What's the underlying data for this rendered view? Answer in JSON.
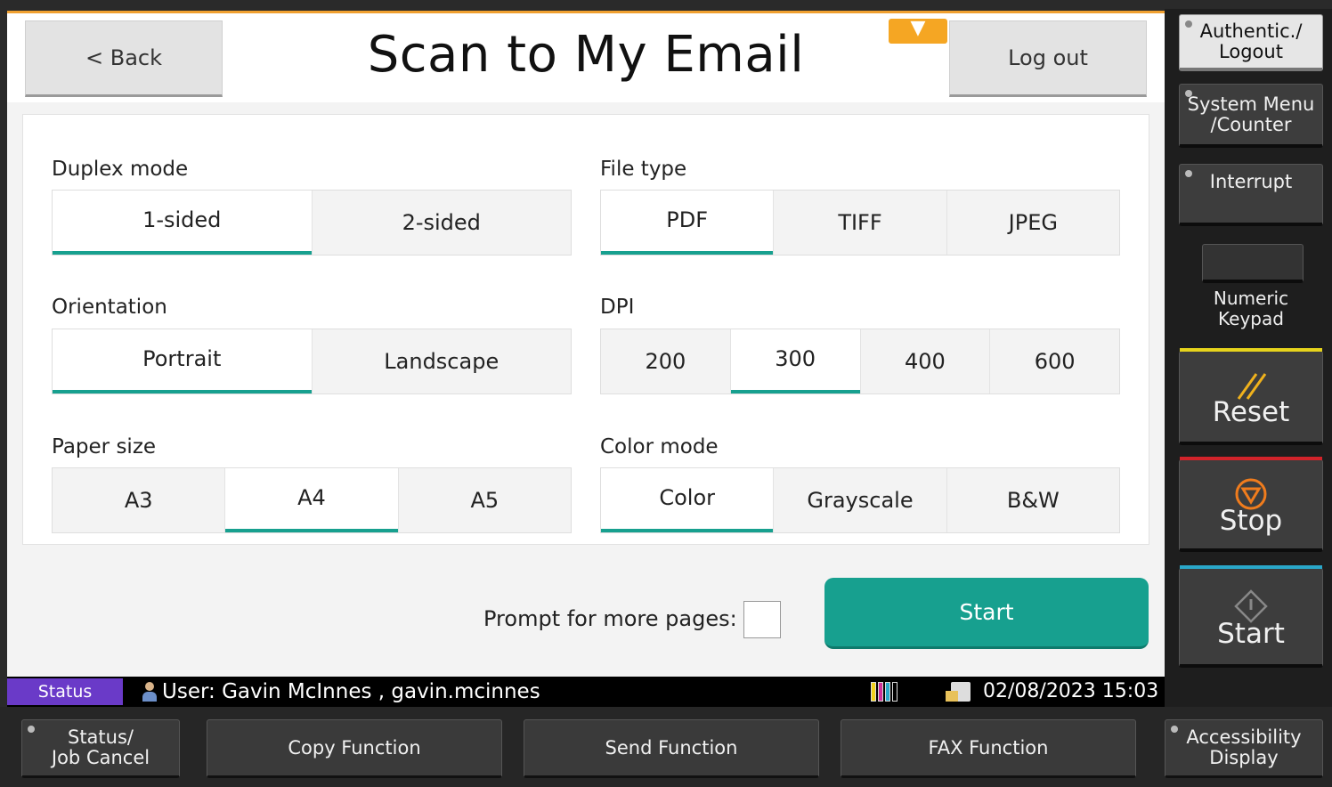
{
  "header": {
    "back_label": "< Back",
    "title": "Scan to My Email",
    "logout_label": "Log out",
    "dropdown_icon": "caret-down-icon"
  },
  "settings": {
    "duplex": {
      "label": "Duplex mode",
      "options": [
        "1-sided",
        "2-sided"
      ],
      "selected": "1-sided"
    },
    "file_type": {
      "label": "File type",
      "options": [
        "PDF",
        "TIFF",
        "JPEG"
      ],
      "selected": "PDF"
    },
    "orientation": {
      "label": "Orientation",
      "options": [
        "Portrait",
        "Landscape"
      ],
      "selected": "Portrait"
    },
    "dpi": {
      "label": "DPI",
      "options": [
        "200",
        "300",
        "400",
        "600"
      ],
      "selected": "300"
    },
    "paper_size": {
      "label": "Paper size",
      "options": [
        "A3",
        "A4",
        "A5"
      ],
      "selected": "A4"
    },
    "color_mode": {
      "label": "Color mode",
      "options": [
        "Color",
        "Grayscale",
        "B&W"
      ],
      "selected": "Color"
    }
  },
  "prompt": {
    "label": "Prompt for more pages:",
    "checked": false
  },
  "start_label": "Start",
  "statusbar": {
    "status_label": "Status",
    "user": "User: Gavin McInnes , gavin.mcinnes",
    "datetime": "02/08/2023  15:03"
  },
  "function_bar": {
    "status_job_cancel": "Status/\nJob Cancel",
    "copy": "Copy Function",
    "send": "Send Function",
    "fax": "FAX Function",
    "accessibility": "Accessibility\nDisplay"
  },
  "hardware": {
    "authentic_logout": "Authentic./\nLogout",
    "system_menu": "System Menu\n/Counter",
    "interrupt": "Interrupt",
    "numeric_keypad": "Numeric\nKeypad",
    "reset": "Reset",
    "stop": "Stop",
    "start": "Start"
  },
  "colors": {
    "accent": "#17a08f",
    "status_tag": "#6a3ac8",
    "reset_bar": "#e6d31c",
    "stop_bar": "#d2232a",
    "start_bar": "#2aa7c9",
    "icon_orange": "#f07c1d"
  }
}
